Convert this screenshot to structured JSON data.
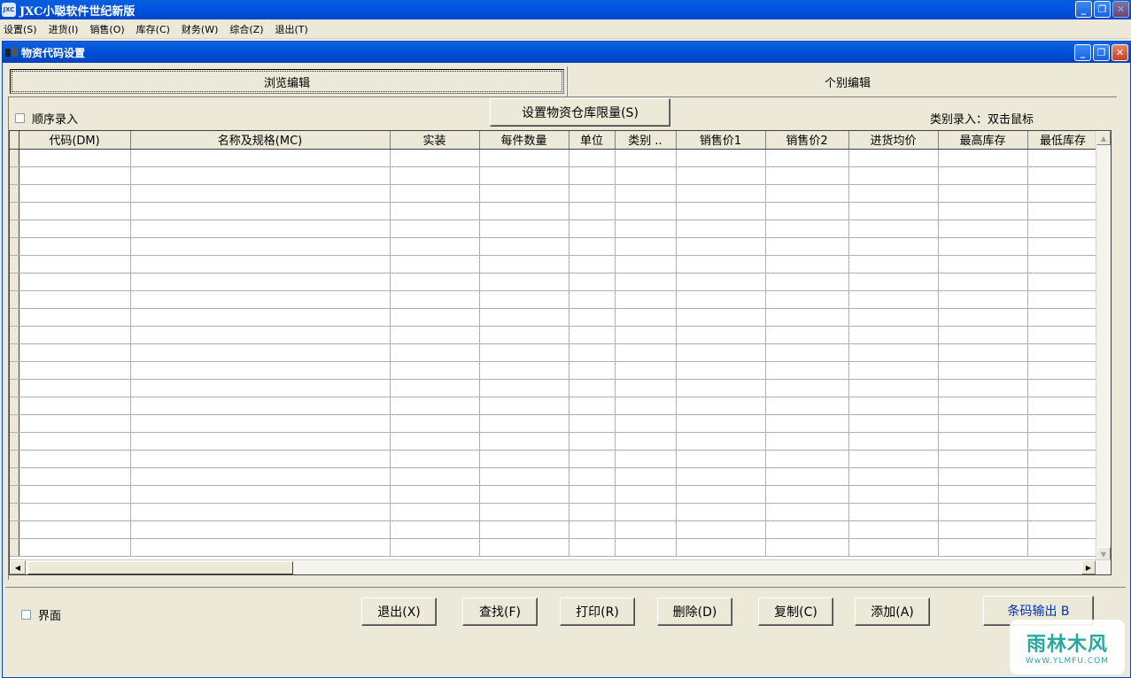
{
  "app": {
    "title": "JXC小聪软件世纪新版",
    "icon_text": "JXC"
  },
  "menu": [
    {
      "label": "设置(S)"
    },
    {
      "label": "进货(I)"
    },
    {
      "label": "销售(O)"
    },
    {
      "label": "库存(C)"
    },
    {
      "label": "财务(W)"
    },
    {
      "label": "综合(Z)"
    },
    {
      "label": "退出(T)"
    }
  ],
  "child_window": {
    "title": "物资代码设置"
  },
  "tabs": [
    {
      "label": "浏览编辑",
      "active": true
    },
    {
      "label": "个别编辑",
      "active": false
    }
  ],
  "toolbar": {
    "sequential_checkbox_label": "顺序录入",
    "sequential_checked": false,
    "set_limit_button": "设置物资仓库限量(S)",
    "category_hint": "类别录入：双击鼠标"
  },
  "grid": {
    "columns": [
      "代码(DM)",
      "名称及规格(MC)",
      "实装",
      "每件数量",
      "单位",
      "类别 ..",
      "销售价1",
      "销售价2",
      "进货均价",
      "最高库存",
      "最低库存"
    ]
  },
  "bottom": {
    "interface_checkbox_label": "界面",
    "interface_checked": false,
    "buttons": {
      "exit": "退出(X)",
      "find": "查找(F)",
      "print": "打印(R)",
      "delete": "删除(D)",
      "copy": "复制(C)",
      "add": "添加(A)",
      "barcode": "条码输出 B"
    }
  },
  "watermark": {
    "text": "雨林木风",
    "url": "WwW.YLMFU.COM"
  },
  "colors": {
    "titlebar": "#0055e5",
    "window_bg": "#ece9d8",
    "close_button": "#c8401e"
  }
}
